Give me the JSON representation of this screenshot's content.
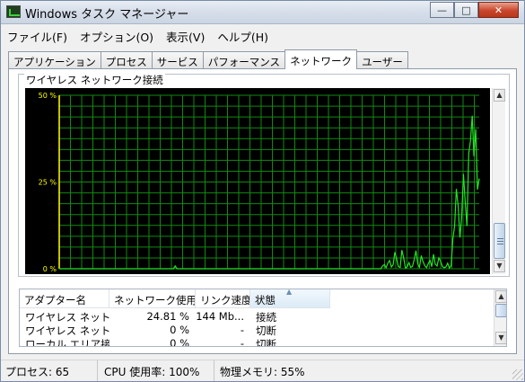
{
  "window": {
    "title": "Windows タスク マネージャー",
    "minimize_label": "—",
    "maximize_label": "□",
    "close_label": "✕"
  },
  "menu": {
    "items": [
      "ファイル(F)",
      "オプション(O)",
      "表示(V)",
      "ヘルプ(H)"
    ]
  },
  "tabs": {
    "items": [
      "アプリケーション",
      "プロセス",
      "サービス",
      "パフォーマンス",
      "ネットワーク",
      "ユーザー"
    ],
    "active": "ネットワーク"
  },
  "network": {
    "graph_title": "ワイヤレス ネットワーク接続"
  },
  "chart_data": {
    "type": "line",
    "title": "ワイヤレス ネットワーク接続",
    "ylim": [
      0,
      50
    ],
    "y_ticks": [
      "50 %",
      "25 %",
      "0 %"
    ],
    "grid": true,
    "line_color": "#22e622",
    "grid_color": "#118a11",
    "background": "#000000",
    "series": [
      {
        "values": [
          0,
          0,
          0,
          0,
          0,
          0,
          0,
          0,
          0,
          0,
          0,
          0,
          0,
          0,
          0,
          0,
          0,
          0,
          0,
          0,
          0,
          0,
          0,
          0,
          0,
          0,
          0,
          0,
          0,
          0,
          0,
          0,
          0,
          0,
          0,
          0,
          0,
          0,
          0,
          0,
          0,
          0,
          0,
          0,
          0,
          0,
          0,
          0,
          0,
          0,
          0,
          0,
          0,
          0,
          0,
          0,
          0,
          0,
          0,
          0,
          0,
          0,
          0,
          0,
          0,
          0,
          0.8,
          0,
          0,
          0,
          0,
          0,
          0,
          0,
          0,
          0,
          0,
          0,
          0,
          0,
          0,
          0,
          0,
          0,
          0,
          0,
          0,
          0,
          0,
          0,
          0,
          0,
          0,
          0,
          0,
          0,
          0,
          0,
          0,
          0,
          0,
          0,
          0,
          0,
          0,
          0,
          0,
          0,
          0,
          0,
          0,
          0,
          0,
          0,
          0,
          0,
          0,
          0,
          0,
          0,
          0,
          0,
          0,
          0,
          0,
          0,
          0,
          0,
          0,
          0,
          0,
          0,
          0,
          0,
          0,
          0,
          0,
          0,
          0,
          0,
          0,
          0,
          0,
          0,
          0,
          0,
          0,
          0,
          0,
          0,
          0,
          0,
          0,
          0,
          0,
          0,
          0,
          0,
          0,
          0,
          0,
          0,
          0,
          0,
          0,
          0,
          0,
          0,
          0,
          0,
          0,
          0,
          0,
          0,
          0,
          0,
          0,
          0,
          0,
          0,
          0,
          0,
          0,
          0,
          0.8,
          1.2,
          0.3,
          1.6,
          2.4,
          0.5,
          1.2,
          4.8,
          2.8,
          0.6,
          0.4,
          5.4,
          3.1,
          0.2,
          0.6,
          1.8,
          0.4,
          0.7,
          2.6,
          5.2,
          1.4,
          0.5,
          3.8,
          2.1,
          0.9,
          0.3,
          1.5,
          2.4,
          0.6,
          4.2,
          1.3,
          0.8,
          3.1,
          2.2,
          0.7,
          0.3,
          0.5,
          1.6,
          0.2,
          0.9,
          8.6,
          12.4,
          23.0,
          18.2,
          9.0,
          14.8,
          27.3,
          19.6,
          12.3,
          33.2,
          36.8,
          44.1,
          32.4,
          40.2,
          22.8,
          26.0
        ]
      }
    ]
  },
  "table": {
    "columns": [
      "アダプター名",
      "ネットワーク使用...",
      "リンク速度",
      "状態"
    ],
    "rows": [
      [
        "ワイヤレス ネット...",
        "24.81 %",
        "144 Mb...",
        "接続"
      ],
      [
        "ワイヤレス ネット...",
        "0 %",
        "-",
        "切断"
      ],
      [
        "ローカル エリア接...",
        "0 %",
        "-",
        "切断"
      ]
    ]
  },
  "status": {
    "processes": "プロセス: 65",
    "cpu": "CPU 使用率: 100%",
    "memory": "物理メモリ: 55%"
  }
}
